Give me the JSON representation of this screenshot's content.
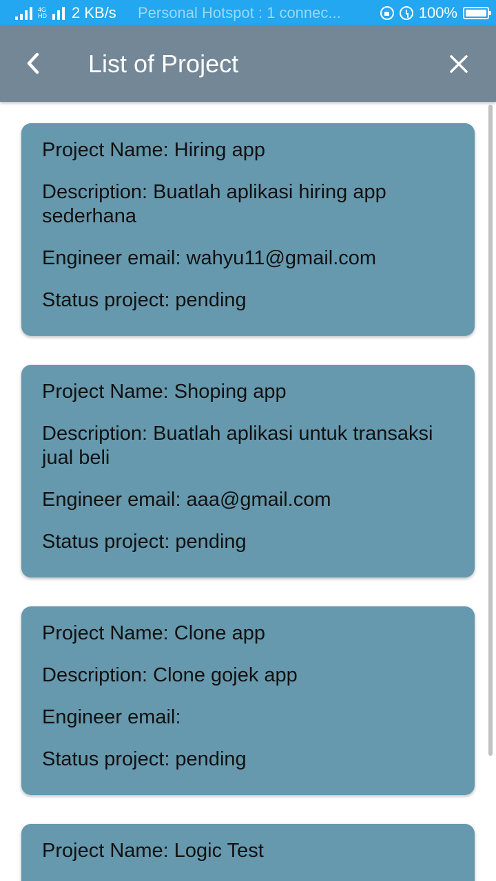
{
  "status_bar": {
    "network_tag_top": "4G",
    "network_tag_bottom": "HD",
    "speed": "2 KB/s",
    "hotspot": "Personal Hotspot : 1 connec...",
    "battery": "100%"
  },
  "app_bar": {
    "title": "List of Project",
    "back_icon": "chevron-left-icon",
    "close_icon": "close-icon"
  },
  "projects": [
    {
      "name": "Project Name: Hiring app",
      "description": "Description: Buatlah aplikasi hiring app sederhana",
      "email": "Engineer email: wahyu11@gmail.com",
      "status": "Status project: pending"
    },
    {
      "name": "Project Name: Shoping app",
      "description": "Description: Buatlah aplikasi untuk transaksi jual beli",
      "email": "Engineer email: aaa@gmail.com",
      "status": "Status project: pending"
    },
    {
      "name": "Project Name: Clone app",
      "description": "Description: Clone gojek app",
      "email": "Engineer email:",
      "status": "Status project: pending"
    },
    {
      "name": "Project Name: Logic Test"
    }
  ],
  "colors": {
    "status_bar": "#22a7f0",
    "app_bar": "#748797",
    "card": "#6699ae"
  }
}
